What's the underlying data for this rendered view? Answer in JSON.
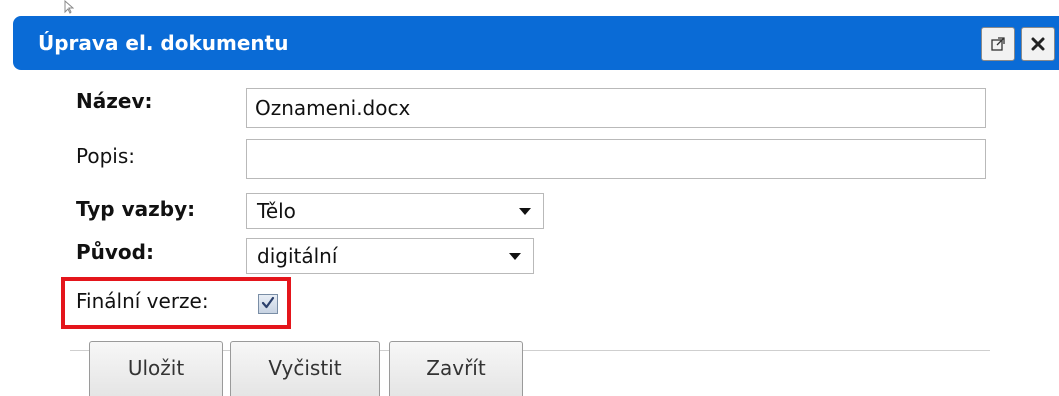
{
  "dialog": {
    "title": "Úprava el. dokumentu",
    "popout_icon": "external-link-icon",
    "close_icon": "close-icon"
  },
  "form": {
    "name_label": "Název:",
    "name_value": "Oznameni.docx",
    "description_label": "Popis:",
    "description_value": "",
    "binding_type_label": "Typ vazby:",
    "binding_type_value": "Tělo",
    "origin_label": "Původ:",
    "origin_value": "digitální",
    "final_version_label": "Finální verze:",
    "final_version_checked": true
  },
  "buttons": {
    "save": "Uložit",
    "clear": "Vyčistit",
    "close": "Zavřít"
  },
  "colors": {
    "titlebar": "#0a6bd6",
    "highlight": "#e4151b"
  }
}
